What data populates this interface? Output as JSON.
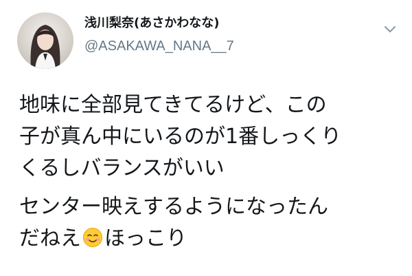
{
  "tweet": {
    "author": {
      "display_name": "浅川梨奈(あさかわなな)",
      "handle": "@ASAKAWA_NANA__7",
      "avatar_icon": "profile-photo"
    },
    "menu_icon": "chevron-down-icon",
    "text": {
      "paragraph1": {
        "line1": "地味に全部見てきてるけど、この",
        "line2": "子が真ん中にいるのが1番しっくり",
        "line3": "くるしバランスがいい"
      },
      "paragraph2": {
        "line1": "センター映えするようになったん",
        "line2_before": "だねえ",
        "emoji": "smiling-face-icon",
        "line2_after": "ほっこり"
      }
    }
  }
}
